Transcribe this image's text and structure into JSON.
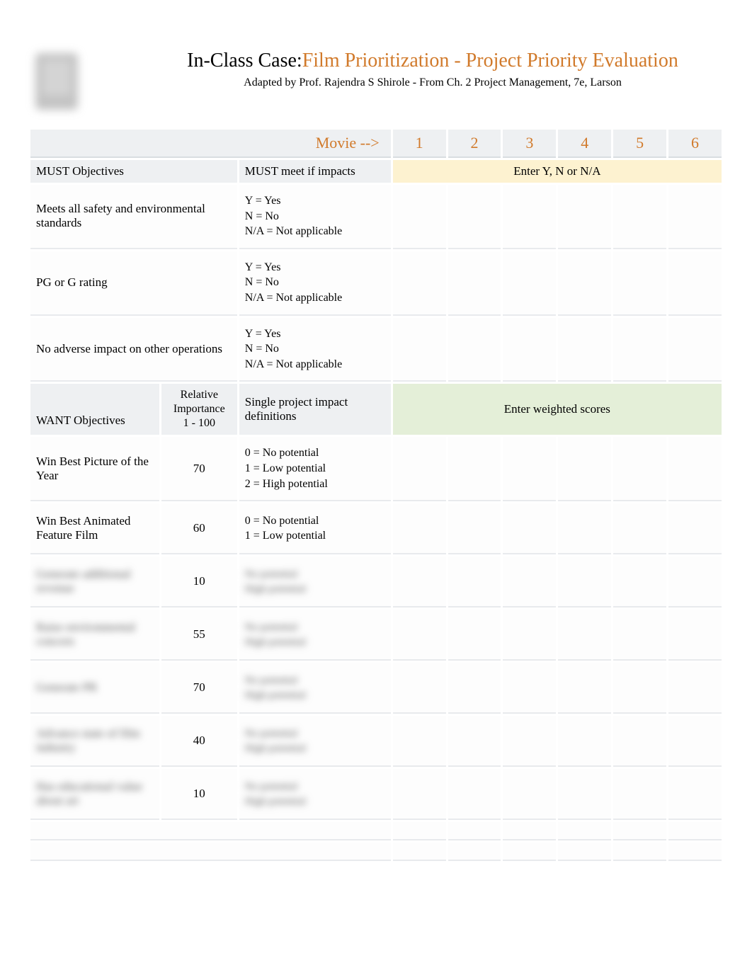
{
  "header": {
    "title_prefix": "In-Class Case:",
    "title_main": "Film Prioritization - Project Priority Evaluation",
    "subtitle": "Adapted by Prof. Rajendra S Shirole - From Ch. 2 Project Management, 7e, Larson"
  },
  "movie_row": {
    "label": "Movie -->",
    "numbers": [
      "1",
      "2",
      "3",
      "4",
      "5",
      "6"
    ]
  },
  "must": {
    "section_label": "MUST Objectives",
    "meet_label": "MUST meet if impacts",
    "enter_label": "Enter Y, N or N/A",
    "legend": "Y = Yes\nN = No\nN/A = Not applicable",
    "items": [
      "Meets all safety and environmental standards",
      "PG or G rating",
      "No adverse impact on other operations"
    ]
  },
  "want": {
    "section_label": "WANT Objectives",
    "importance_header": "Relative\nImportance\n1 - 100",
    "definitions_header": "Single project impact definitions",
    "enter_label": "Enter weighted scores",
    "items": [
      {
        "label": "Win Best Picture of the Year",
        "importance": "70",
        "definition": "0 = No potential\n1 = Low potential\n2 = High potential",
        "blurred": false
      },
      {
        "label": "Win Best Animated Feature Film",
        "importance": "60",
        "definition": "0 = No potential\n1 = Low potential",
        "blurred": false
      },
      {
        "label": "Generate additional revenue",
        "importance": "10",
        "definition": "No potential\nHigh potential",
        "blurred": true
      },
      {
        "label": "Raise environmental concern",
        "importance": "55",
        "definition": "No potential\nHigh potential",
        "blurred": true
      },
      {
        "label": "Generate PR",
        "importance": "70",
        "definition": "No potential\nHigh potential",
        "blurred": true
      },
      {
        "label": "Advance state of film industry",
        "importance": "40",
        "definition": "No potential\nHigh potential",
        "blurred": true
      },
      {
        "label": "Has educational value about art",
        "importance": "10",
        "definition": "No potential\nHigh potential",
        "blurred": true
      }
    ]
  }
}
